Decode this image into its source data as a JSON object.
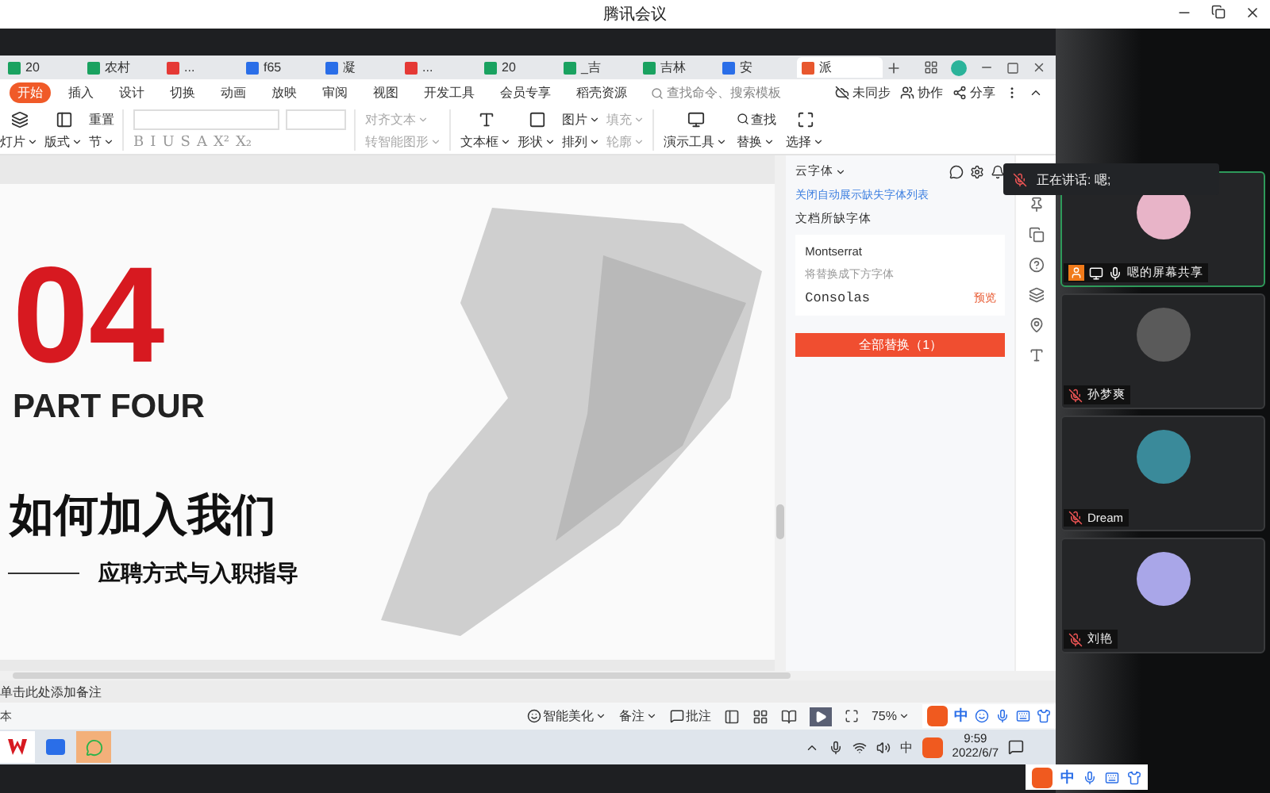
{
  "window": {
    "title": "腾讯会议"
  },
  "wps": {
    "doc_tabs": [
      {
        "label": "20",
        "kind": "sheet",
        "selected": false
      },
      {
        "label": "农村",
        "kind": "sheet",
        "selected": false
      },
      {
        "label": "...",
        "kind": "pdf",
        "selected": false
      },
      {
        "label": "f65",
        "kind": "doc",
        "selected": false
      },
      {
        "label": "凝",
        "kind": "doc",
        "selected": false
      },
      {
        "label": "...",
        "kind": "pdf",
        "selected": false
      },
      {
        "label": "20",
        "kind": "sheet",
        "selected": false
      },
      {
        "label": "_吉",
        "kind": "sheet",
        "selected": false
      },
      {
        "label": "吉林",
        "kind": "sheet",
        "selected": false
      },
      {
        "label": "安",
        "kind": "doc",
        "selected": false
      },
      {
        "label": "派",
        "kind": "slides",
        "selected": true
      }
    ],
    "ribbon_tabs": [
      {
        "label": "开始",
        "selected": true
      },
      {
        "label": "插入",
        "selected": false
      },
      {
        "label": "设计",
        "selected": false
      },
      {
        "label": "切换",
        "selected": false
      },
      {
        "label": "动画",
        "selected": false
      },
      {
        "label": "放映",
        "selected": false
      },
      {
        "label": "审阅",
        "selected": false
      },
      {
        "label": "视图",
        "selected": false
      },
      {
        "label": "开发工具",
        "selected": false
      },
      {
        "label": "会员专享",
        "selected": false
      },
      {
        "label": "稻壳资源",
        "selected": false
      }
    ],
    "search": {
      "placeholder": "查找命令、搜索模板"
    },
    "sync_actions": [
      "未同步",
      "协作",
      "分享"
    ],
    "toolbar": {
      "slide": "灯片",
      "layout": "版式",
      "reset": "重置",
      "section": "节",
      "format_buttons": [
        "B",
        "I",
        "U",
        "S",
        "A",
        "X²",
        "X₂"
      ],
      "align_text": "对齐文本",
      "smart_art": "转智能图形",
      "text_box": "文本框",
      "shape": "形状",
      "picture": "图片",
      "arrange": "排列",
      "fill": "填充",
      "outline": "轮廓",
      "present_tools": "演示工具",
      "find": "查找",
      "replace": "替换",
      "select": "选择"
    },
    "slide": {
      "number": "04",
      "part": "PART FOUR",
      "heading": "如何加入我们",
      "subheading": "应聘方式与入职指导"
    },
    "font_panel": {
      "title": "云字体",
      "link": "关闭自动展示缺失字体列表",
      "section": "文档所缺字体",
      "missing_font": "Montserrat",
      "hint": "将替换成下方字体",
      "replacement_font": "Consolas",
      "preview": "预览",
      "replace_all": "全部替换（1）"
    },
    "notes": {
      "placeholder": "单击此处添加备注"
    },
    "status_bar": {
      "left": "本",
      "beautify": "智能美化",
      "notes": "备注",
      "comments": "批注",
      "zoom": "75%"
    },
    "ime": {
      "mode": "中"
    }
  },
  "taskbar": {
    "ime": "中",
    "time": "9:59",
    "date": "2022/6/7"
  },
  "meeting": {
    "speaking": "正在讲话: 嗯;",
    "participants": [
      {
        "name": "嗯的屏幕共享",
        "kind": "sharing",
        "active": true,
        "color": "#e8b4c8"
      },
      {
        "name": "孙梦爽",
        "kind": "muted",
        "active": false,
        "color": "#5a5a5a"
      },
      {
        "name": "Dream",
        "kind": "muted",
        "active": false,
        "color": "#3a8a9a"
      },
      {
        "name": "刘艳",
        "kind": "muted",
        "active": false,
        "color": "#a9a6e8"
      }
    ]
  },
  "floating_ime": {
    "mode": "中"
  }
}
